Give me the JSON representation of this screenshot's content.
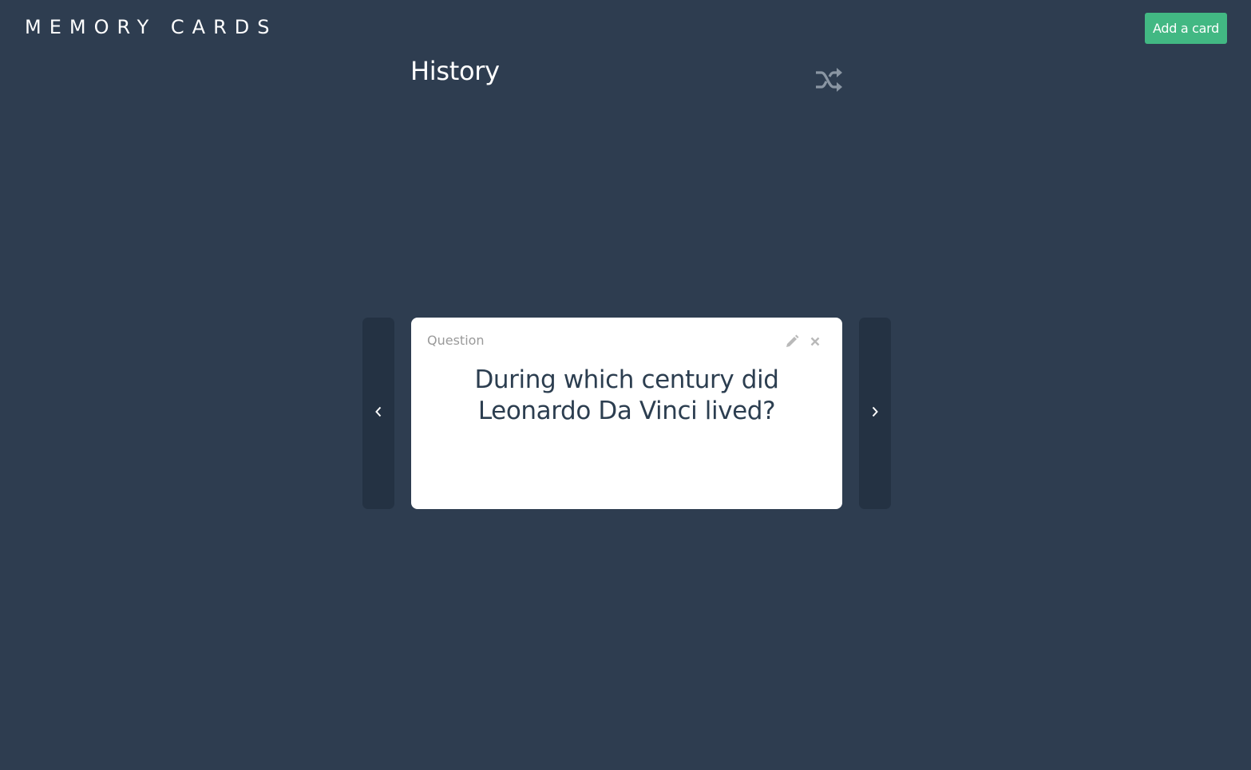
{
  "header": {
    "logo": "MEMORY CARDS",
    "add_button_label": "Add a card"
  },
  "deck": {
    "title": "History",
    "shuffle_icon": "shuffle-icon"
  },
  "card": {
    "side_label": "Question",
    "text": "During which century did Leonardo Da Vinci lived?",
    "edit_icon": "pencil-icon",
    "delete_icon": "close-icon"
  },
  "navigation": {
    "prev_icon": "chevron-left-icon",
    "next_icon": "chevron-right-icon"
  },
  "colors": {
    "background": "#2e3d50",
    "accent": "#42b883",
    "card": "#ffffff",
    "nav": "#243243"
  }
}
